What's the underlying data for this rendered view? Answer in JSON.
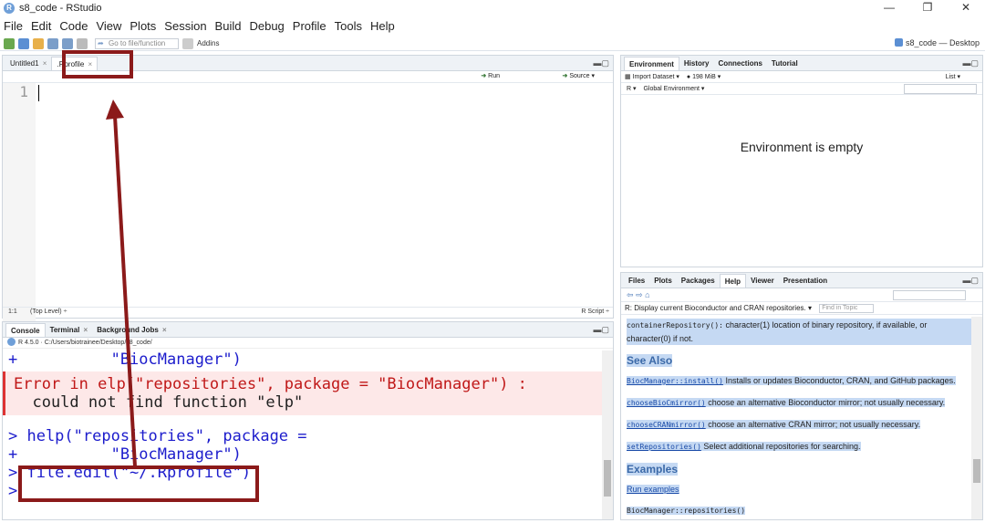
{
  "window": {
    "title": "s8_code - RStudio"
  },
  "menu": [
    "File",
    "Edit",
    "Code",
    "View",
    "Plots",
    "Session",
    "Build",
    "Debug",
    "Profile",
    "Tools",
    "Help"
  ],
  "toolbar": {
    "goto_placeholder": "Go to file/function",
    "addins": "Addins",
    "project": "s8_code — Desktop"
  },
  "source": {
    "tabs": [
      {
        "label": "Untitled1"
      },
      {
        "label": ".Rprofile"
      }
    ],
    "run": "Run",
    "source_btn": "Source",
    "line_number": "1",
    "status_pos": "1:1",
    "status_scope": "(Top Level) ÷",
    "status_type": "R Script ÷"
  },
  "console": {
    "tabs": [
      "Console",
      "Terminal",
      "Background Jobs"
    ],
    "path": "R 4.5.0 · C:/Users/biotrainee/Desktop/s8_code/",
    "lines": {
      "l1": "+          \"BiocManager\")",
      "err1": "Error in elp(\"repositories\", package = \"BiocManager\") :",
      "err2": "  could not find function \"elp\"",
      "l4": "> help(\"repositories\", package =",
      "l5": "+          \"BiocManager\")",
      "l6": "> file.edit(\"~/.Rprofile\")",
      "l7": ">"
    }
  },
  "environment": {
    "tabs": [
      "Environment",
      "History",
      "Connections",
      "Tutorial"
    ],
    "import": "Import Dataset",
    "memory": "198 MiB",
    "list": "List",
    "lang": "R",
    "scope": "Global Environment",
    "empty": "Environment is empty"
  },
  "help": {
    "tabs": [
      "Files",
      "Plots",
      "Packages",
      "Help",
      "Viewer",
      "Presentation"
    ],
    "topic": "R: Display current Bioconductor and CRAN repositories.",
    "find": "Find in Topic",
    "intro_code": "containerRepository():",
    "intro_text": " character(1) location of binary repository, if available, or character(0) if not.",
    "see_also": "See Also",
    "items": [
      {
        "link": "BiocManager::install()",
        "text": " Installs or updates Bioconductor, CRAN, and GitHub packages."
      },
      {
        "link": "chooseBioCmirror()",
        "text": " choose an alternative Bioconductor mirror; not usually necessary."
      },
      {
        "link": "chooseCRANmirror()",
        "text": " choose an alternative CRAN mirror; not usually necessary."
      },
      {
        "link": "setRepositories()",
        "text": " Select additional repositories for searching."
      }
    ],
    "examples": "Examples",
    "run_examples": "Run examples",
    "example_code": "BiocManager::repositories()"
  }
}
